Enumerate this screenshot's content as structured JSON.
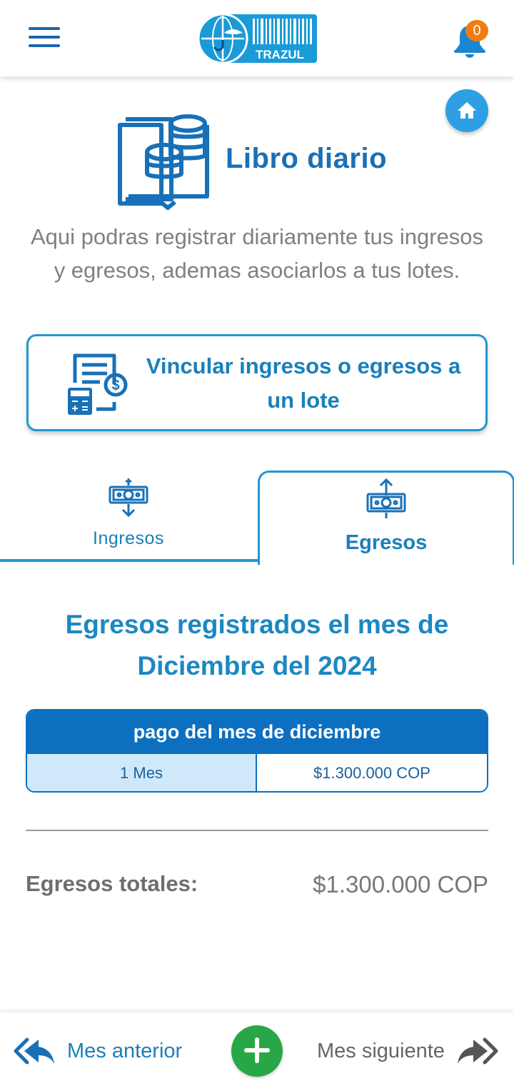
{
  "header": {
    "logo_text": "TRAZUL",
    "notification_count": "0"
  },
  "hero": {
    "title": "Libro diario",
    "description": "Aqui podras registrar diariamente tus ingresos y egresos, ademas asociarlos a tus lotes."
  },
  "link_card": {
    "label": "Vincular ingresos o egresos a un lote"
  },
  "tabs": [
    {
      "label": "Ingresos",
      "active": false
    },
    {
      "label": "Egresos",
      "active": true
    }
  ],
  "section": {
    "title": "Egresos registrados el mes de Diciembre del 2024"
  },
  "records": [
    {
      "title": "pago del mes de diciembre",
      "period": "1 Mes",
      "amount": "$1.300.000 COP"
    }
  ],
  "totals": {
    "label": "Egresos totales:",
    "value": "$1.300.000 COP"
  },
  "bottom_nav": {
    "prev_label": "Mes anterior",
    "next_label": "Mes siguiente"
  },
  "colors": {
    "primary": "#1b7fba",
    "accent_blue": "#2196d3",
    "table_head": "#0d6fbf",
    "badge_orange": "#f07d10",
    "add_green": "#27a745"
  }
}
